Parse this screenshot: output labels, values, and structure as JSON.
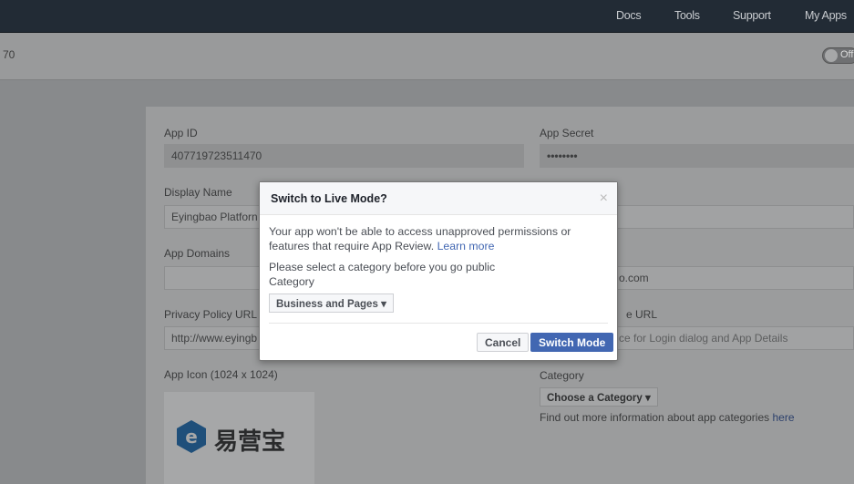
{
  "topnav": [
    "Docs",
    "Tools",
    "Support",
    "My Apps"
  ],
  "subheader": {
    "app_id_fragment": "70",
    "toggle_label": "Off"
  },
  "form": {
    "app_id_label": "App ID",
    "app_id": "407719723511470",
    "app_secret_label": "App Secret",
    "app_secret": "••••••••",
    "display_name_label": "Display Name",
    "display_name": "Eyingbao Platforn",
    "app_domains_label": "App Domains",
    "privacy_label": "Privacy Policy URL",
    "privacy_value": "http://www.eyingb",
    "app_icon_label": "App Icon (1024 x 1024)",
    "logo_text": "易营宝",
    "right_domain_fragment": "o.com",
    "right_url_label_fragment": "e URL",
    "right_url_placeholder_fragment": "ce for Login dialog and App Details",
    "category_label": "Category",
    "category_button": "Choose a Category",
    "category_help": "Find out more information about app categories ",
    "category_help_link": "here"
  },
  "modal": {
    "title": "Switch to Live Mode?",
    "close": "×",
    "message": "Your app won't be able to access unapproved permissions or features that require App Review. ",
    "learn_more": "Learn more",
    "select_prompt": "Please select a category before you go public",
    "category_label": "Category",
    "category_value": "Business and Pages",
    "cancel": "Cancel",
    "confirm": "Switch Mode"
  }
}
